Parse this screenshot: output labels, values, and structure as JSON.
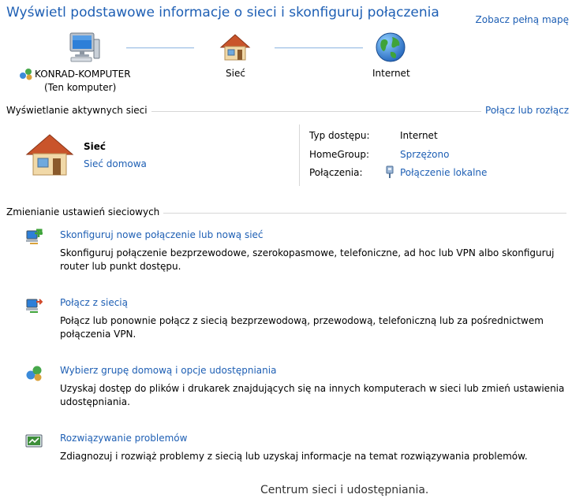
{
  "header": {
    "title": "Wyświetl podstawowe informacje o sieci i skonfiguruj połączenia",
    "full_map_link": "Zobacz pełną mapę"
  },
  "network_map": {
    "computer_name": "KONRAD-KOMPUTER",
    "computer_sub": "(Ten komputer)",
    "network_label": "Sieć",
    "internet_label": "Internet"
  },
  "active_networks": {
    "heading": "Wyświetlanie aktywnych sieci",
    "connect_link": "Połącz lub rozłącz",
    "network_name": "Sieć",
    "network_type": "Sieć domowa",
    "access_type_label": "Typ dostępu:",
    "access_type_value": "Internet",
    "homegroup_label": "HomeGroup:",
    "homegroup_value": "Sprzężono",
    "connections_label": "Połączenia:",
    "connections_value": "Połączenie lokalne"
  },
  "change_settings": {
    "heading": "Zmienianie ustawień sieciowych",
    "tasks": [
      {
        "title": "Skonfiguruj nowe połączenie lub nową sieć",
        "description": "Skonfiguruj połączenie bezprzewodowe, szerokopasmowe, telefoniczne, ad hoc lub VPN albo skonfiguruj router lub punkt dostępu."
      },
      {
        "title": "Połącz z siecią",
        "description": "Połącz lub ponownie połącz z siecią bezprzewodową, przewodową, telefoniczną lub za pośrednictwem połączenia VPN."
      },
      {
        "title": "Wybierz grupę domową i opcje udostępniania",
        "description": "Uzyskaj dostęp do plików i drukarek znajdujących się na innych komputerach w sieci lub zmień ustawienia udostępniania."
      },
      {
        "title": "Rozwiązywanie problemów",
        "description": "Zdiagnozuj i rozwiąż problemy z siecią lub uzyskaj informacje na temat rozwiązywania problemów."
      }
    ]
  },
  "caption": "Centrum sieci i udostępniania.",
  "colors": {
    "link": "#1e5fb4",
    "divider": "#d7d7d7"
  }
}
